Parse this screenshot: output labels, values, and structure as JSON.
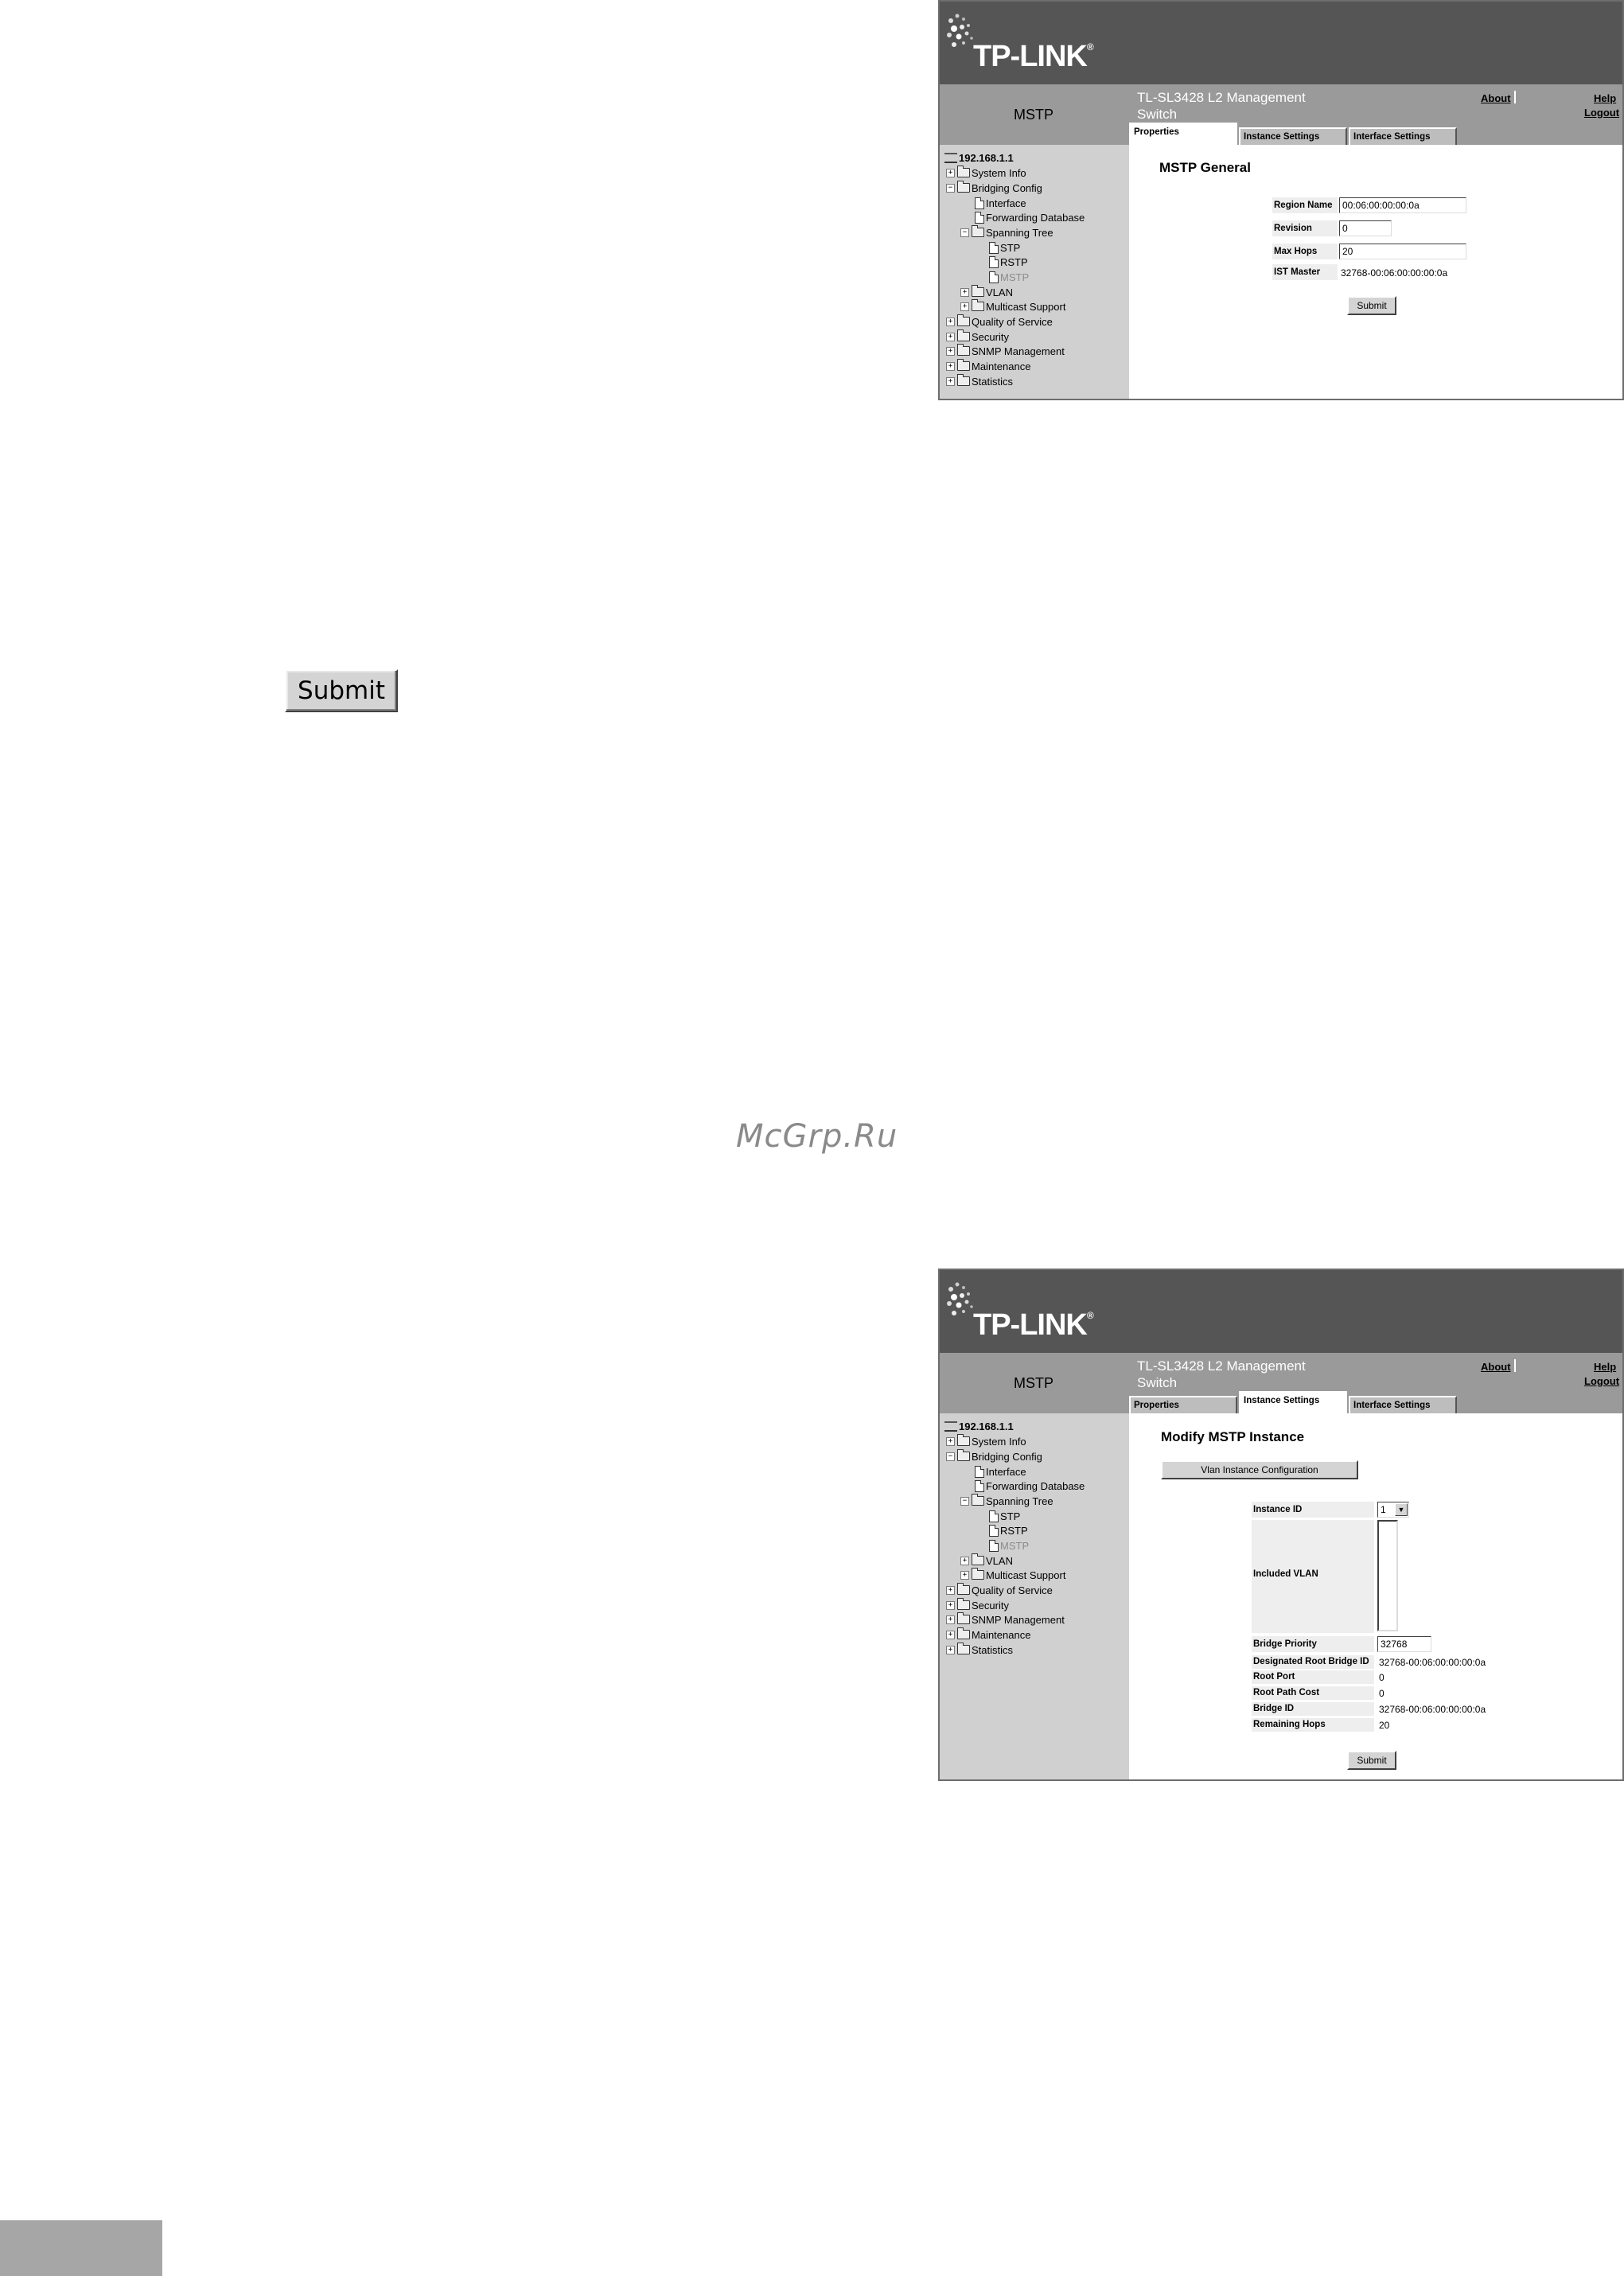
{
  "standalone": {
    "submit_label": "Submit"
  },
  "watermark": "McGrp.Ru",
  "common": {
    "logo": "TP-LINK",
    "logo_mark": "®",
    "page_name": "MSTP",
    "product_line1": "TL-SL3428 L2 Management",
    "product_line2": "Switch",
    "about": "About",
    "help": "Help",
    "logout": "Logout",
    "tabs": [
      "Properties",
      "Instance Settings",
      "Interface Settings"
    ],
    "tree": {
      "root": "192.168.1.1",
      "system_info": "System Info",
      "bridging_config": "Bridging Config",
      "interface": "Interface",
      "forwarding_database": "Forwarding Database",
      "spanning_tree": "Spanning Tree",
      "stp": "STP",
      "rstp": "RSTP",
      "mstp": "MSTP",
      "vlan": "VLAN",
      "multicast_support": "Multicast Support",
      "quality_of_service": "Quality of Service",
      "security": "Security",
      "snmp_management": "SNMP Management",
      "maintenance": "Maintenance",
      "statistics": "Statistics"
    }
  },
  "general": {
    "title": "MSTP General",
    "region_name_label": "Region Name",
    "region_name_value": "00:06:00:00:00:0a",
    "revision_label": "Revision",
    "revision_value": "0",
    "max_hops_label": "Max Hops",
    "max_hops_value": "20",
    "ist_master_label": "IST Master",
    "ist_master_value": "32768-00:06:00:00:00:0a",
    "submit_label": "Submit"
  },
  "instance": {
    "title": "Modify MSTP Instance",
    "vlan_config_button": "Vlan Instance Configuration",
    "instance_id_label": "Instance ID",
    "instance_id_value": "1",
    "included_vlan_label": "Included VLAN",
    "bridge_priority_label": "Bridge Priority",
    "bridge_priority_value": "32768",
    "designated_root_label": "Designated Root Bridge ID",
    "designated_root_value": "32768-00:06:00:00:00:0a",
    "root_port_label": "Root Port",
    "root_port_value": "0",
    "root_path_cost_label": "Root Path Cost",
    "root_path_cost_value": "0",
    "bridge_id_label": "Bridge ID",
    "bridge_id_value": "32768-00:06:00:00:00:0a",
    "remaining_hops_label": "Remaining Hops",
    "remaining_hops_value": "20",
    "submit_label": "Submit"
  }
}
